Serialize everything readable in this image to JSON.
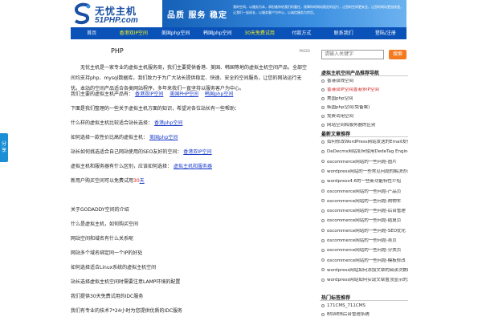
{
  "header": {
    "logo_cn": "无忧主机",
    "logo_en": "51PHP.com",
    "slogan": "品质 服务 稳定",
    "banner_desc": "我的空间，以服务为本，承担着你给我们的重任，保障你的网站稳定的运行，让您的空间更安全，让您的网站更加快速，让我们一起成长，以服务客户为中心，以诚信服务为宗旨。"
  },
  "nav": [
    {
      "label": "首页",
      "highlight": false
    },
    {
      "label": "香港双IP空间",
      "highlight": true
    },
    {
      "label": "美国php空间",
      "highlight": false
    },
    {
      "label": "韩国php空间",
      "highlight": false
    },
    {
      "label": "30天免费试用",
      "highlight": true
    },
    {
      "label": "付款方式",
      "highlight": false
    },
    {
      "label": "联系我们",
      "highlight": false
    },
    {
      "label": "登陆/注册",
      "highlight": false
    }
  ],
  "share": {
    "label": "分享"
  },
  "article": {
    "title": "PHP",
    "meta": "PAGED",
    "intro": "　　无忧主机是一家专业的虚拟主机服务商，我们主要提供香港、美国、韩国等地的虚拟主机空间产品，全部空间均支持php、mysql数据库，我们致力于为广大站长提供稳定、快速、安全的空间服务，让您的网站运行无忧。本站的空间产品适合各类网站程序，多年来我们一直坚持以服务客户为中心。",
    "lines": [
      {
        "text": "我们主要的虚拟主机产品有：",
        "link": "香港双IP空间",
        "link2": "美国PHP空间",
        "link3": "韩国php空间"
      },
      {
        "text": "下面是我们整理的一些关于虚拟主机方面的知识，希望对各位站长有一些帮助："
      },
      {
        "text": "什么样的虚拟主机比较适合站长选择：",
        "link": "香港php空间"
      },
      {
        "text": "如何选择一款性价比高的虚拟主机：",
        "link": "美国php空间"
      },
      {
        "text": "站长如何挑选适合自己网站使用的SEO友好的空间：",
        "link": "香港双IP空间"
      },
      {
        "text": "虚拟主机和服务器有什么区别，应该如何选择：",
        "link": "虚拟主机和服务器"
      },
      {
        "text": "新用户购买空间可以免费试用",
        "red": "30",
        "tail": "天"
      },
      {
        "text": "关于GODADDY空间的介绍"
      },
      {
        "text": "什么是虚拟主机，如何购买空间"
      },
      {
        "text": "网站空间和域名有什么关系呢"
      },
      {
        "text": "网站多个域名绑定同一个IP的好处"
      },
      {
        "text": "如何选择适合Linux系统的虚拟主机空间"
      },
      {
        "text": "站长选择虚拟主机空间时需要注意LAMP环境的配置"
      },
      {
        "text": "我们提供30天免费试用的IDC服务"
      },
      {
        "text": "我们有专业的技术7*24小时为您提供优质的IDC服务"
      }
    ]
  },
  "sidebar": {
    "search_placeholder": "请输入关键字",
    "search_button": "搜索",
    "section1_title": "虚拟主机空间产品推荐导航",
    "section1_items": [
      {
        "label": "香港双线空间",
        "color": "#333333"
      },
      {
        "label": "香港双IP空间香港多IP空间",
        "color": "#d22222"
      },
      {
        "label": "美国php空间",
        "color": "#333333"
      },
      {
        "label": "韩国php空间(免备案)",
        "color": "#333333"
      },
      {
        "label": "免费试用空间",
        "color": "#333333"
      },
      {
        "label": "网站空间和服务器的区别",
        "color": "#333333"
      }
    ],
    "section2_title": "最新文章推荐",
    "section2_items": [
      "如何修改WordPress网站发送的Email发件人名称",
      "DeDecms网站如何使用DedeTag Engine Create File False问题",
      "oscommerce网站的一些问题-图片",
      "wordpress网站的一些常见问题的解决办法",
      "wordpress4.6的一些新功能特性介绍",
      "oscommerce网站的一些问题-产品页",
      "oscommerce网站的一些问题-购物车",
      "oscommerce网站的一些问题-后台管理",
      "oscommerce网站的一些问题-结算页",
      "oscommerce网站的一些问题-SEO优化",
      "oscommerce网站的一些问题-首页",
      "oscommerce网站的一些问题-分类页",
      "oscommerce网站的一些问题-模板修改",
      "wordpress网站如何添加文章的阅读次数统计",
      "wordpress网站如何实现文章置顶显示的方法介绍"
    ],
    "section3_title": "热门标签推荐",
    "section3_items": [
      "171CMS_711CMS",
      "BSWEB后台管理系统"
    ]
  },
  "colors": {
    "nav_bg": "#0a52b8",
    "nav_highlight": "#f6f01c",
    "search_button": "#f5791f",
    "link": "#1a3cc8",
    "share_bg": "#1b8fd6"
  }
}
